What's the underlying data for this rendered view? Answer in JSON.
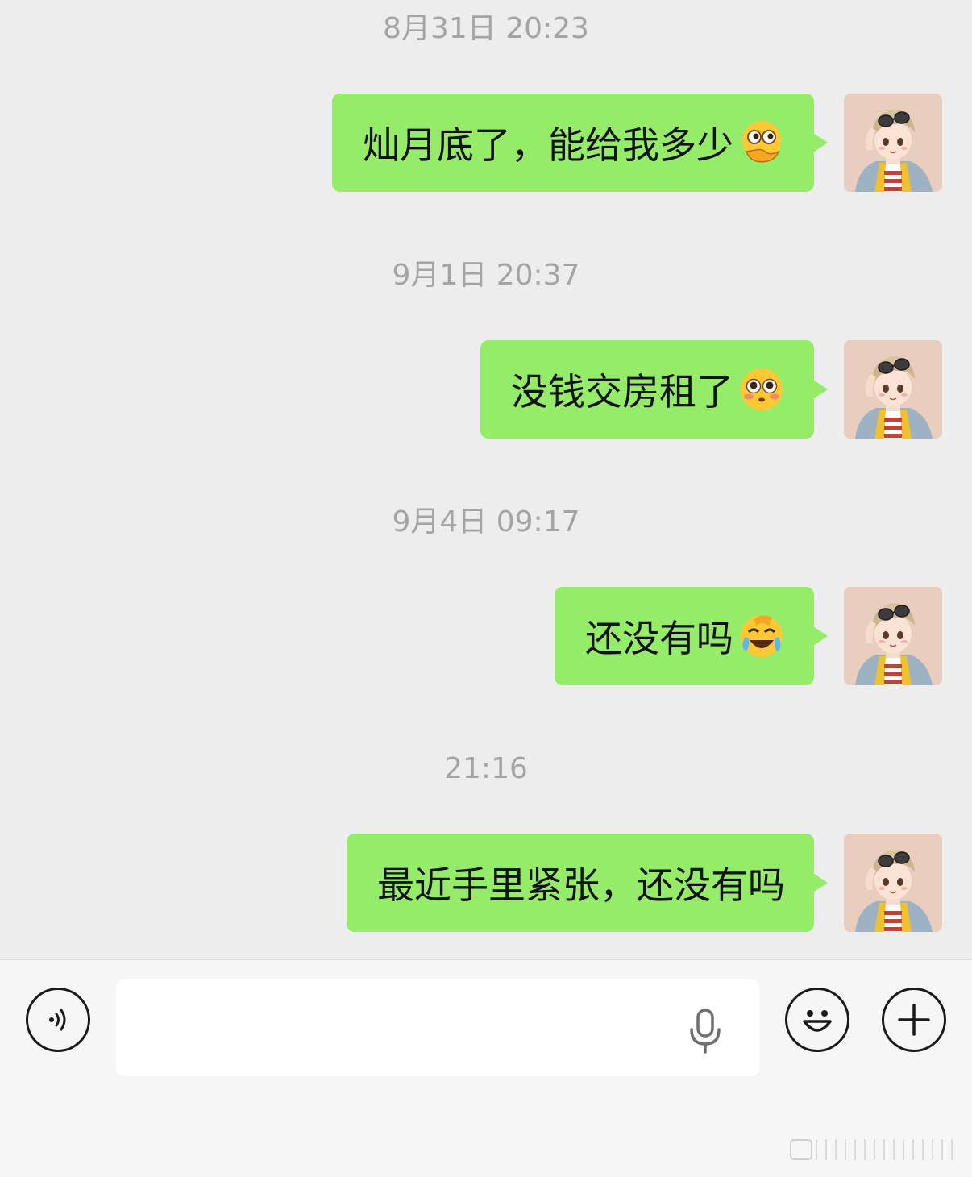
{
  "chat": {
    "timestamps": [
      "8月31日 20:23",
      "9月1日 20:37",
      "9月4日 09:17",
      "21:16"
    ],
    "messages": [
      {
        "text": "灿月底了，能给我多少",
        "emoji": "thinking-hand-over-face-emoji"
      },
      {
        "text": "没钱交房租了",
        "emoji": "pleading-face-emoji"
      },
      {
        "text": "还没有吗",
        "emoji": "crying-laughing-emoji"
      },
      {
        "text": "最近手里紧张，还没有吗",
        "emoji": ""
      }
    ],
    "avatar": "anime-boy-sunglasses-avatar"
  },
  "input_bar": {
    "text_value": "",
    "icons": [
      "voice-icon",
      "microphone-icon",
      "emoji-icon",
      "plus-icon"
    ]
  },
  "colors": {
    "background": "#ededed",
    "bubble": "#95ec69",
    "timestamp": "#a4a4a4",
    "input_bar": "#f6f6f6"
  }
}
